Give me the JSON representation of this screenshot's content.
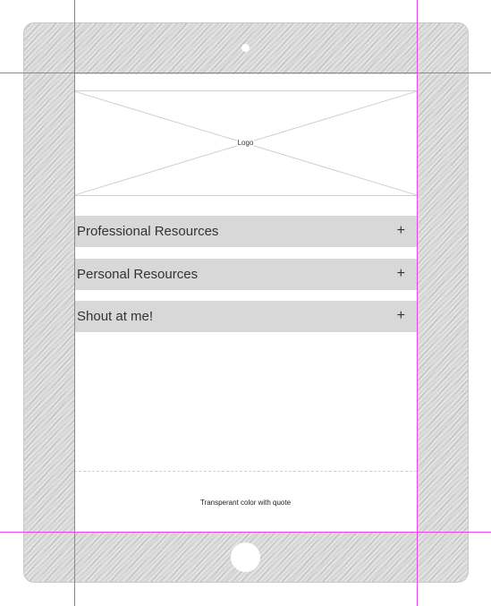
{
  "logo": {
    "label": "Logo"
  },
  "menu": {
    "items": [
      {
        "label": "Professional Resources",
        "toggle": "+"
      },
      {
        "label": "Personal Resources",
        "toggle": "+"
      },
      {
        "label": "Shout at me!",
        "toggle": "+"
      }
    ]
  },
  "footer": {
    "quote_placeholder": "Transperant color with quote"
  },
  "colors": {
    "device_frame": "#d6d6d6",
    "menu_background": "#d8d8d8",
    "guide_lines": "#ee44ee"
  }
}
